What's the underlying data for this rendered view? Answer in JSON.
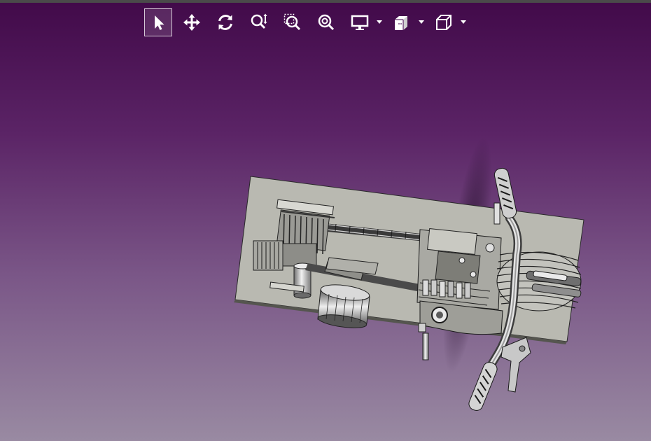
{
  "app": {
    "accent_color": "#ffffff",
    "background_top": "#420a4a",
    "background_bottom": "#998aa2",
    "plate_color": "#b8b8b0"
  },
  "toolbar": {
    "tools": [
      {
        "name": "select",
        "icon": "pointer-arrow-icon",
        "active": true
      },
      {
        "name": "pan",
        "icon": "move-arrows-icon",
        "active": false
      },
      {
        "name": "rotate",
        "icon": "rotate-icon",
        "active": false
      },
      {
        "name": "zoom",
        "icon": "zoom-updown-icon",
        "active": false
      },
      {
        "name": "zoom-window",
        "icon": "zoom-window-icon",
        "active": false
      },
      {
        "name": "zoom-fit",
        "icon": "zoom-fit-icon",
        "active": false
      },
      {
        "name": "display-mode",
        "icon": "monitor-icon",
        "has_dropdown": true
      },
      {
        "name": "section-view",
        "icon": "section-view-icon",
        "has_dropdown": true
      },
      {
        "name": "view-orientation",
        "icon": "cube-icon",
        "has_dropdown": true
      }
    ]
  },
  "model": {
    "description_icon": "engine-assembly-3d-model"
  }
}
